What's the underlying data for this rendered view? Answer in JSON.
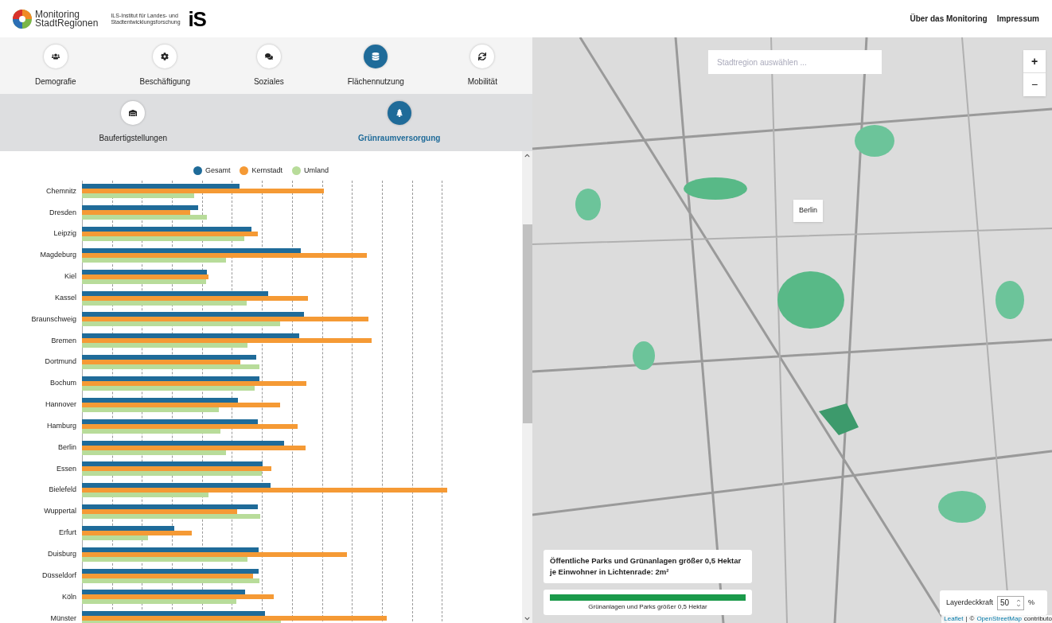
{
  "header": {
    "logo_title": [
      "Monitoring",
      "StadtRegionen"
    ],
    "institute": [
      "ILS-Institut für Landes- und",
      "Stadtentwicklungsforschung"
    ],
    "institute_logo": "iS",
    "nav": [
      "Über das Monitoring",
      "Impressum"
    ]
  },
  "tabs": [
    {
      "label": "Demografie",
      "selected": false
    },
    {
      "label": "Beschäftigung",
      "selected": false
    },
    {
      "label": "Soziales",
      "selected": false
    },
    {
      "label": "Flächennutzung",
      "selected": true
    },
    {
      "label": "Mobilität",
      "selected": false
    }
  ],
  "subtabs": [
    {
      "label": "Baufertigstellungen",
      "selected": false
    },
    {
      "label": "Grünraumversorgung",
      "selected": true
    }
  ],
  "chart": {
    "legend": [
      {
        "name": "Gesamt",
        "color": "#1f6b99"
      },
      {
        "name": "Kernstadt",
        "color": "#f59a35"
      },
      {
        "name": "Umland",
        "color": "#b8dc9a"
      }
    ],
    "categories": [
      "Chemnitz",
      "Dresden",
      "Leipzig",
      "Magdeburg",
      "Kiel",
      "Kassel",
      "Braunschweig",
      "Bremen",
      "Dortmund",
      "Bochum",
      "Hannover",
      "Hamburg",
      "Berlin",
      "Essen",
      "Bielefeld",
      "Wuppertal",
      "Erfurt",
      "Duisburg",
      "Düsseldorf",
      "Köln",
      "Münster"
    ]
  },
  "map": {
    "search": {
      "placeholder": "Stadtregion auswählen ..."
    },
    "zoom_in": "+",
    "zoom_out": "−",
    "popup": "Berlin",
    "info": "Öffentliche Parks und Grünanlagen größer 0,5 Hektar je Einwohner in Lichtenrade: 2m²",
    "legend": "Grünanlagen und Parks größer 0,5 Hektar",
    "opacity": {
      "label": "Layerdeckkraft",
      "value": "50",
      "unit": "%"
    },
    "attribution": {
      "links": [
        "Leaflet",
        "OpenStreetMap"
      ],
      "separator": "|",
      "prefix": "©",
      "suffix": "contributo"
    }
  }
}
